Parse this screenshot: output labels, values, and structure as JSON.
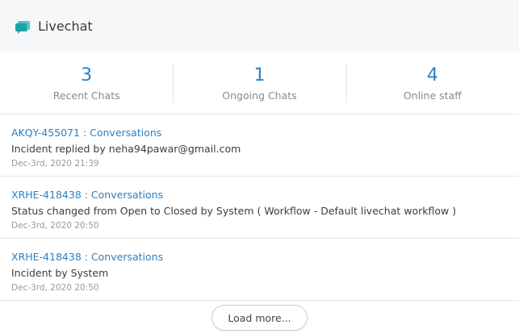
{
  "header": {
    "title": "Livechat",
    "icon": "chat-bubbles-icon",
    "accent": "#26b1b1"
  },
  "stats": [
    {
      "value": "3",
      "label": "Recent Chats"
    },
    {
      "value": "1",
      "label": "Ongoing Chats"
    },
    {
      "value": "4",
      "label": "Online staff"
    }
  ],
  "items": [
    {
      "link": "AKQY-455071 : Conversations",
      "description": "Incident replied by neha94pawar@gmail.com",
      "timestamp": "Dec-3rd, 2020 21:39"
    },
    {
      "link": "XRHE-418438 : Conversations",
      "description": "Status changed from Open to Closed by System ( Workflow - Default livechat workflow )",
      "timestamp": "Dec-3rd, 2020 20:50"
    },
    {
      "link": "XRHE-418438 : Conversations",
      "description": "Incident by System",
      "timestamp": "Dec-3rd, 2020 20:50"
    }
  ],
  "footer": {
    "load_more_label": "Load more..."
  },
  "colors": {
    "link": "#2e7fc0",
    "header_bg": "#f6f7f9"
  }
}
